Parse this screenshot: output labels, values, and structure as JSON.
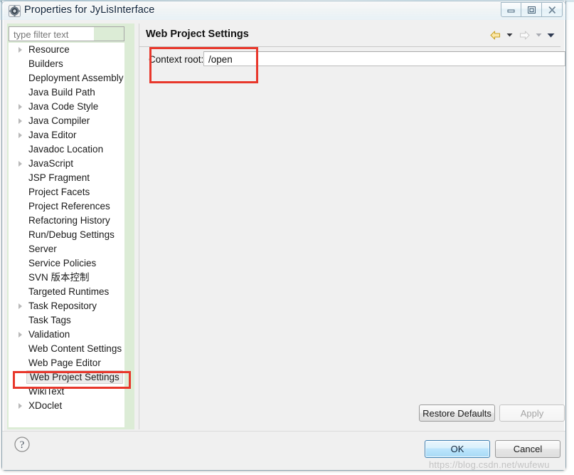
{
  "window": {
    "title": "Properties for JyLisInterface",
    "icon": "eclipse-properties-icon",
    "controls": {
      "minimize": "minimize-button",
      "maximize": "maximize-button",
      "close": "close-button"
    }
  },
  "sidebar": {
    "filter": {
      "value": "",
      "placeholder": "type filter text"
    },
    "items": [
      {
        "label": "Resource",
        "expandable": true,
        "selected": false
      },
      {
        "label": "Builders",
        "expandable": false,
        "selected": false
      },
      {
        "label": "Deployment Assembly",
        "expandable": false,
        "selected": false
      },
      {
        "label": "Java Build Path",
        "expandable": false,
        "selected": false
      },
      {
        "label": "Java Code Style",
        "expandable": true,
        "selected": false
      },
      {
        "label": "Java Compiler",
        "expandable": true,
        "selected": false
      },
      {
        "label": "Java Editor",
        "expandable": true,
        "selected": false
      },
      {
        "label": "Javadoc Location",
        "expandable": false,
        "selected": false
      },
      {
        "label": "JavaScript",
        "expandable": true,
        "selected": false
      },
      {
        "label": "JSP Fragment",
        "expandable": false,
        "selected": false
      },
      {
        "label": "Project Facets",
        "expandable": false,
        "selected": false
      },
      {
        "label": "Project References",
        "expandable": false,
        "selected": false
      },
      {
        "label": "Refactoring History",
        "expandable": false,
        "selected": false
      },
      {
        "label": "Run/Debug Settings",
        "expandable": false,
        "selected": false
      },
      {
        "label": "Server",
        "expandable": false,
        "selected": false
      },
      {
        "label": "Service Policies",
        "expandable": false,
        "selected": false
      },
      {
        "label": "SVN 版本控制",
        "expandable": false,
        "selected": false
      },
      {
        "label": "Targeted Runtimes",
        "expandable": false,
        "selected": false
      },
      {
        "label": "Task Repository",
        "expandable": true,
        "selected": false
      },
      {
        "label": "Task Tags",
        "expandable": false,
        "selected": false
      },
      {
        "label": "Validation",
        "expandable": true,
        "selected": false
      },
      {
        "label": "Web Content Settings",
        "expandable": false,
        "selected": false
      },
      {
        "label": "Web Page Editor",
        "expandable": false,
        "selected": false
      },
      {
        "label": "Web Project Settings",
        "expandable": false,
        "selected": true
      },
      {
        "label": "WikiText",
        "expandable": false,
        "selected": false
      },
      {
        "label": "XDoclet",
        "expandable": true,
        "selected": false
      }
    ]
  },
  "content": {
    "title": "Web Project Settings",
    "nav": {
      "back_icon": "back-arrow-icon",
      "back_menu_icon": "chevron-down-icon",
      "forward_icon": "forward-arrow-icon",
      "forward_menu_icon": "chevron-down-icon",
      "menu_icon": "chevron-down-icon"
    },
    "context_root": {
      "label": "Context root:",
      "value": "/open",
      "placeholder": ""
    }
  },
  "buttons": {
    "restore_defaults": "Restore Defaults",
    "apply": "Apply",
    "ok": "OK",
    "cancel": "Cancel",
    "help_icon": "help-question-icon"
  },
  "annotations": {
    "color": "#e8372b",
    "boxes": [
      "context-root-row",
      "web-project-settings-tree-item"
    ]
  },
  "watermark": {
    "text": "https://blog.csdn.net/wufewu"
  }
}
